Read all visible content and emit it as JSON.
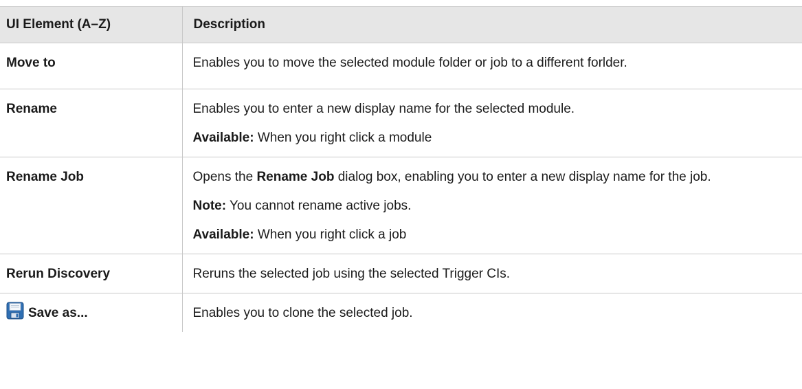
{
  "table": {
    "headers": [
      "UI Element (A–Z)",
      "Description"
    ],
    "rows": [
      {
        "element": "Move to",
        "desc1": "Enables you to move the selected module folder or job to a different forlder."
      },
      {
        "element": "Rename",
        "desc1": "Enables you to enter a new display name for the selected module.",
        "avail_label": "Available:",
        "avail_text": " When you right click a module"
      },
      {
        "element": "Rename Job",
        "desc_pre": "Opens the ",
        "desc_bold": "Rename Job",
        "desc_post": " dialog box, enabling you to enter a new display name for the job.",
        "note_label": "Note:",
        "note_text": " You cannot rename active jobs.",
        "avail_label": "Available:",
        "avail_text": " When you right click a job"
      },
      {
        "element": "Rerun Discovery",
        "desc1": "Reruns the selected job using the selected Trigger CIs."
      },
      {
        "element": "Save as...",
        "icon": "save-floppy-icon",
        "desc1": "Enables you to clone the selected job."
      }
    ]
  }
}
